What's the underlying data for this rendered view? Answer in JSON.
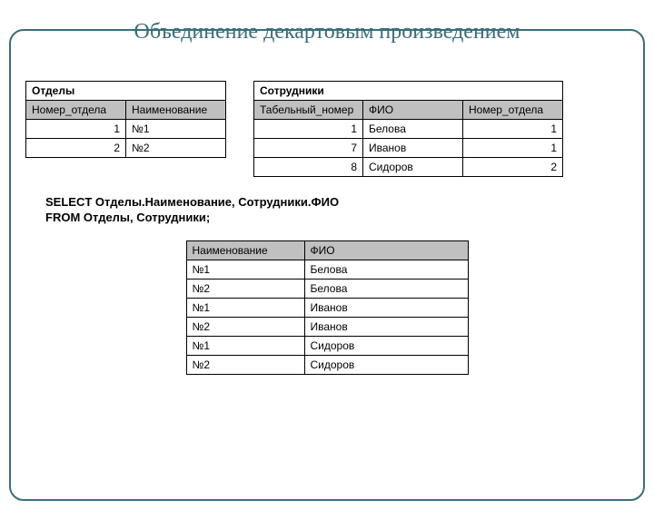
{
  "title": "Объединение декартовым произведением",
  "departments": {
    "caption": "Отделы",
    "headers": [
      "Номер_отдела",
      "Наименование"
    ],
    "rows": [
      [
        "1",
        "№1"
      ],
      [
        "2",
        "№2"
      ]
    ]
  },
  "employees": {
    "caption": "Сотрудники",
    "headers": [
      "Табельный_номер",
      "ФИО",
      "Номер_отдела"
    ],
    "rows": [
      [
        "1",
        "Белова",
        "1"
      ],
      [
        "7",
        "Иванов",
        "1"
      ],
      [
        "8",
        "Сидоров",
        "2"
      ]
    ]
  },
  "sql": "SELECT Отделы.Наименование, Сотрудники.ФИО\nFROM Отделы, Сотрудники;",
  "result": {
    "headers": [
      "Наименование",
      "ФИО"
    ],
    "rows": [
      [
        "№1",
        "Белова"
      ],
      [
        "№2",
        "Белова"
      ],
      [
        "№1",
        "Иванов"
      ],
      [
        "№2",
        "Иванов"
      ],
      [
        "№1",
        "Сидоров"
      ],
      [
        "№2",
        "Сидоров"
      ]
    ]
  }
}
